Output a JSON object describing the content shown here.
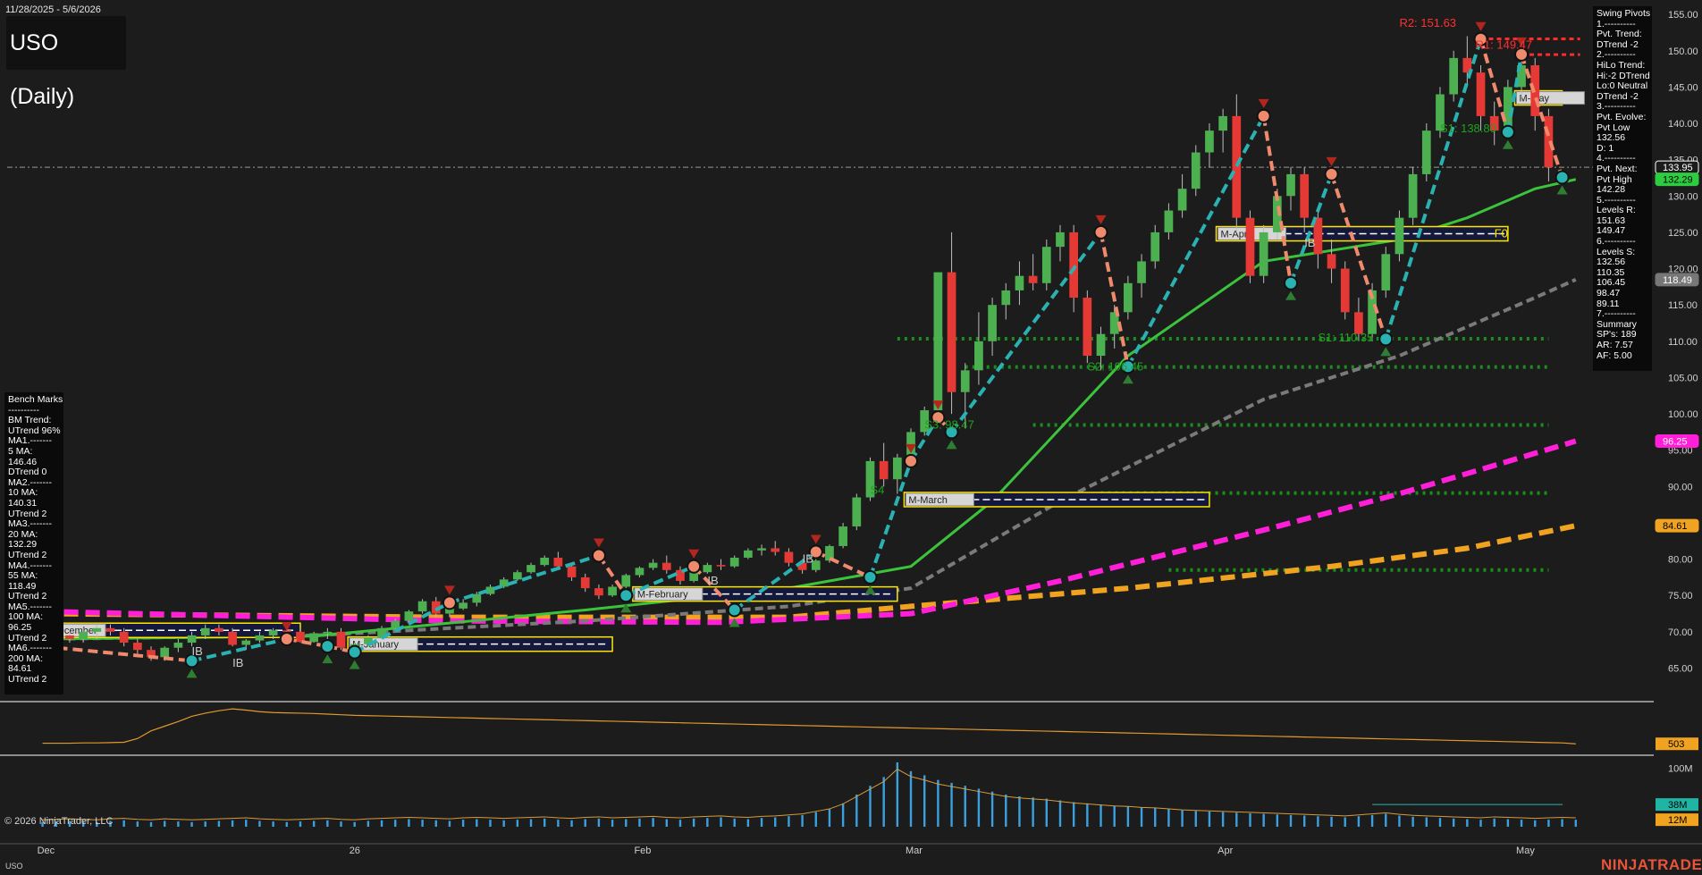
{
  "date_range": "11/28/2025 - 5/6/2026",
  "title": "USO (Daily)",
  "copyright": "© 2026 NinjaTrader, LLC",
  "ticker": "USO",
  "brand": "NINJATRADER",
  "swing_pivots": {
    "lines": [
      "Swing Pivots",
      "1.----------",
      "Pvt. Trend:",
      "DTrend -2",
      "2.----------",
      "HiLo Trend:",
      "Hi:-2 DTrend",
      "Lo:0 Neutral",
      "DTrend -2",
      "3.----------",
      "Pvt. Evolve:",
      "Pvt Low",
      "132.56",
      "D: 1",
      "4.----------",
      "Pvt. Next:",
      "Pvt High",
      "142.28",
      "5.----------",
      "Levels R:",
      "151.63",
      "149.47",
      "6.----------",
      "Levels S:",
      "132.56",
      "110.35",
      "106.45",
      "98.47",
      "89.11",
      "7.----------",
      "Summary",
      "SP's: 189",
      "AR: 7.57",
      "AF: 5.00"
    ]
  },
  "bench_marks": {
    "lines": [
      "Bench Marks",
      "----------",
      "BM Trend:",
      "UTrend 96%",
      "MA1.-------",
      "5 MA:",
      "146.46",
      "DTrend 0",
      "MA2.-------",
      "10 MA:",
      "140.31",
      "UTrend 2",
      "MA3.-------",
      "20 MA:",
      "132.29",
      "UTrend 2",
      "MA4.-------",
      "55 MA:",
      "118.49",
      "UTrend 2",
      "MA5.-------",
      "100 MA:",
      "96.25",
      "UTrend 2",
      "MA6.-------",
      "200 MA:",
      "84.61",
      "UTrend 2"
    ]
  },
  "annotations": {
    "r1": "R1: 149.47",
    "r2": "R2: 151.63",
    "s1_top": "S1: 138.80",
    "s1_mid": "S1: 110.35",
    "s2": "S2: 106.45",
    "s3": "S3: 98.47",
    "s4": "S4",
    "f0": "F0",
    "ib": "IB"
  },
  "month_boxes": [
    "M-December",
    "M-January",
    "M-February",
    "M-March",
    "M-April",
    "M-May"
  ],
  "colors": {
    "background": "#1c1c1c",
    "up_candle": "#4caf50",
    "down_candle": "#e53935",
    "ma5": "#c7c7c7",
    "ma20": "#3cc33c",
    "ma55": "#7a7a7a",
    "ma100": "#ff1fd8",
    "ma200": "#f0a321",
    "swing_up": "#2ab1b1",
    "swing_down": "#f08a6c",
    "resistance": "#ff2a2a",
    "support": "#1a8f1a"
  },
  "chart_data": {
    "type": "candlestick",
    "price_axis": {
      "min": 61,
      "max": 156,
      "ticks": [
        65,
        70,
        75,
        80,
        85,
        90,
        95,
        100,
        105,
        110,
        115,
        120,
        125,
        130,
        135,
        140,
        145,
        150,
        155
      ]
    },
    "x_labels": [
      {
        "label": "Dec",
        "idx": 0
      },
      {
        "label": "26",
        "idx": 23
      },
      {
        "label": "Feb",
        "idx": 44
      },
      {
        "label": "Mar",
        "idx": 64
      },
      {
        "label": "Apr",
        "idx": 87
      },
      {
        "label": "May",
        "idx": 109
      }
    ],
    "price_badges": [
      {
        "label": "133.95",
        "value": 133.95,
        "bg": "#1c1c1c",
        "fg": "#ffffff",
        "border": "#ffffff"
      },
      {
        "label": "132.29",
        "value": 132.29,
        "bg": "#2ecc40",
        "fg": "#000000",
        "border": "#2ecc40"
      },
      {
        "label": "118.49",
        "value": 118.49,
        "bg": "#777777",
        "fg": "#ffffff",
        "border": "#777777"
      },
      {
        "label": "96.25",
        "value": 96.25,
        "bg": "#ff1fd8",
        "fg": "#ffffff",
        "border": "#ff1fd8"
      },
      {
        "label": "84.61",
        "value": 84.61,
        "bg": "#f0a321",
        "fg": "#000000",
        "border": "#f0a321"
      }
    ],
    "candles": [
      [
        68,
        69,
        67,
        68.5
      ],
      [
        68.5,
        70,
        68,
        69.5
      ],
      [
        69.5,
        70,
        68.5,
        69
      ],
      [
        69,
        70.5,
        68.5,
        70
      ],
      [
        70,
        71,
        69,
        70.5
      ],
      [
        70.5,
        71,
        69.5,
        70
      ],
      [
        70,
        70.5,
        68,
        68.5
      ],
      [
        68.5,
        69,
        67,
        67.5
      ],
      [
        67.5,
        68,
        66,
        66.5
      ],
      [
        66.5,
        68,
        66,
        67.8
      ],
      [
        67.8,
        69,
        67.2,
        68.5
      ],
      [
        68.5,
        70,
        68,
        69.5
      ],
      [
        69.5,
        71,
        69,
        70.5
      ],
      [
        70.5,
        71,
        69.5,
        70
      ],
      [
        70,
        70.5,
        68,
        68.2
      ],
      [
        68.2,
        69,
        67.5,
        68.8
      ],
      [
        68.8,
        70,
        68.5,
        69.5
      ],
      [
        69.5,
        70.5,
        69,
        70.2
      ],
      [
        70.2,
        71,
        69.5,
        70
      ],
      [
        70,
        70.5,
        68.5,
        68.6
      ],
      [
        68.6,
        70,
        68.5,
        69.8
      ],
      [
        69.8,
        70.5,
        69,
        70
      ],
      [
        70,
        70.5,
        67.5,
        67.8
      ],
      [
        67.8,
        68.5,
        67,
        68.3
      ],
      [
        68.3,
        69.5,
        68,
        69.2
      ],
      [
        69.2,
        70.8,
        69,
        70.5
      ],
      [
        70.5,
        71.8,
        70.2,
        71.5
      ],
      [
        71.5,
        73,
        71,
        72.8
      ],
      [
        72.8,
        74.5,
        72.5,
        74.2
      ],
      [
        74.2,
        74.8,
        72,
        72.5
      ],
      [
        72.5,
        73.5,
        72,
        73.2
      ],
      [
        73.2,
        74.5,
        73,
        74
      ],
      [
        74,
        75.5,
        73.5,
        75.2
      ],
      [
        75.2,
        76.5,
        75,
        76.2
      ],
      [
        76.2,
        77.5,
        76,
        77.2
      ],
      [
        77.2,
        78.5,
        77,
        78.2
      ],
      [
        78.2,
        79.5,
        78,
        79.2
      ],
      [
        79.2,
        80.5,
        79,
        80.2
      ],
      [
        80.2,
        81,
        78.5,
        79
      ],
      [
        79,
        79.5,
        77,
        77.5
      ],
      [
        77.5,
        78,
        75.5,
        76
      ],
      [
        76,
        76.5,
        74.5,
        75
      ],
      [
        75,
        76.5,
        74.8,
        76.2
      ],
      [
        76.2,
        78,
        76,
        77.8
      ],
      [
        77.8,
        79,
        77.5,
        78.8
      ],
      [
        78.8,
        80,
        78.5,
        79.5
      ],
      [
        79.5,
        80.5,
        78,
        78.5
      ],
      [
        78.5,
        79,
        76.5,
        77
      ],
      [
        77,
        78.5,
        76.8,
        78.2
      ],
      [
        78.2,
        79.5,
        78,
        79.2
      ],
      [
        79.2,
        80,
        78.5,
        79
      ],
      [
        79,
        80.5,
        78.8,
        80.2
      ],
      [
        80.2,
        81.5,
        80,
        81.2
      ],
      [
        81.2,
        82,
        80.5,
        81.5
      ],
      [
        81.5,
        82.5,
        80.5,
        81
      ],
      [
        81,
        81.5,
        79,
        79.5
      ],
      [
        79.5,
        80,
        78,
        78.5
      ],
      [
        78.5,
        80,
        78.2,
        79.8
      ],
      [
        79.8,
        82,
        79.5,
        81.8
      ],
      [
        81.8,
        85,
        81.5,
        84.5
      ],
      [
        84.5,
        89,
        84,
        88.5
      ],
      [
        88.5,
        94,
        88,
        93.5
      ],
      [
        93.5,
        96,
        90,
        91
      ],
      [
        91,
        94.5,
        89,
        94
      ],
      [
        94,
        98,
        93,
        97.5
      ],
      [
        97.5,
        101,
        97,
        100.5
      ],
      [
        100.5,
        112,
        100,
        119.5
      ],
      [
        119.5,
        125,
        100,
        103
      ],
      [
        103,
        107,
        98,
        106
      ],
      [
        106,
        114,
        104,
        110
      ],
      [
        110,
        116,
        108,
        115
      ],
      [
        115,
        118,
        113,
        117
      ],
      [
        117,
        121,
        115,
        119
      ],
      [
        119,
        122,
        117,
        118
      ],
      [
        118,
        124,
        117,
        123
      ],
      [
        123,
        126,
        121,
        125
      ],
      [
        125,
        126,
        114,
        116
      ],
      [
        116,
        117,
        107,
        108
      ],
      [
        108,
        112,
        106,
        111
      ],
      [
        111,
        115,
        109,
        114
      ],
      [
        114,
        119,
        113,
        118
      ],
      [
        118,
        122,
        116,
        121
      ],
      [
        121,
        126,
        120,
        125
      ],
      [
        125,
        129,
        124,
        128
      ],
      [
        128,
        133,
        127,
        131
      ],
      [
        131,
        137,
        130,
        136
      ],
      [
        136,
        140,
        134,
        139
      ],
      [
        139,
        142,
        136,
        141
      ],
      [
        141,
        144,
        125,
        127
      ],
      [
        127,
        128,
        118,
        119
      ],
      [
        119,
        126,
        118,
        125
      ],
      [
        125,
        131,
        124,
        130
      ],
      [
        130,
        134,
        128,
        133
      ],
      [
        133,
        134,
        125,
        127
      ],
      [
        127,
        128,
        120,
        122
      ],
      [
        122,
        124,
        118,
        120
      ],
      [
        120,
        121,
        113,
        114
      ],
      [
        114,
        116,
        110,
        111
      ],
      [
        111,
        118,
        110,
        117
      ],
      [
        117,
        123,
        116,
        122
      ],
      [
        122,
        128,
        121,
        127
      ],
      [
        127,
        134,
        126,
        133
      ],
      [
        133,
        140,
        132,
        139
      ],
      [
        139,
        145,
        138,
        144
      ],
      [
        144,
        150,
        143,
        149
      ],
      [
        149,
        152,
        145,
        147
      ],
      [
        147,
        148,
        139,
        141
      ],
      [
        141,
        143,
        137,
        139
      ],
      [
        139,
        146,
        138,
        145
      ],
      [
        145,
        150,
        143,
        148
      ],
      [
        148,
        149,
        139,
        141
      ],
      [
        141,
        142,
        132,
        133.95
      ]
    ],
    "ma_series": {
      "ma20": [
        [
          0,
          69
        ],
        [
          20,
          69.4
        ],
        [
          40,
          73
        ],
        [
          55,
          76
        ],
        [
          64,
          79
        ],
        [
          70,
          88
        ],
        [
          80,
          108
        ],
        [
          90,
          121
        ],
        [
          100,
          124
        ],
        [
          105,
          127
        ],
        [
          110,
          131
        ],
        [
          113,
          132.29
        ]
      ],
      "ma55": [
        [
          0,
          69
        ],
        [
          20,
          69.5
        ],
        [
          40,
          71.5
        ],
        [
          55,
          73.5
        ],
        [
          64,
          76
        ],
        [
          75,
          88
        ],
        [
          90,
          102
        ],
        [
          100,
          108
        ],
        [
          110,
          116
        ],
        [
          113,
          118.49
        ]
      ],
      "ma100": [
        [
          0,
          72.8
        ],
        [
          30,
          71.5
        ],
        [
          50,
          71.3
        ],
        [
          64,
          72.5
        ],
        [
          75,
          77
        ],
        [
          90,
          84
        ],
        [
          100,
          89
        ],
        [
          113,
          96.25
        ]
      ],
      "ma200": [
        [
          0,
          72.5
        ],
        [
          30,
          72
        ],
        [
          55,
          72
        ],
        [
          64,
          73.5
        ],
        [
          80,
          76
        ],
        [
          95,
          79
        ],
        [
          105,
          81.5
        ],
        [
          113,
          84.61
        ]
      ]
    },
    "swing_points": [
      [
        0,
        68,
        "L"
      ],
      [
        11,
        66,
        "L"
      ],
      [
        18,
        69,
        "H"
      ],
      [
        21,
        68,
        "L"
      ],
      [
        23,
        67.2,
        "L"
      ],
      [
        30,
        74,
        "H"
      ],
      [
        41,
        80.5,
        "H"
      ],
      [
        43,
        75,
        "L"
      ],
      [
        48,
        79,
        "H"
      ],
      [
        51,
        73,
        "L"
      ],
      [
        57,
        81,
        "H"
      ],
      [
        61,
        77.5,
        "L"
      ],
      [
        64,
        93.5,
        "H"
      ],
      [
        66,
        99.5,
        "H"
      ],
      [
        67,
        97.5,
        "L"
      ],
      [
        78,
        125,
        "H"
      ],
      [
        80,
        106.5,
        "L"
      ],
      [
        90,
        141,
        "H"
      ],
      [
        92,
        118,
        "L"
      ],
      [
        95,
        133,
        "H"
      ],
      [
        99,
        110.3,
        "L"
      ],
      [
        106,
        151.6,
        "H"
      ],
      [
        108,
        138.8,
        "L"
      ],
      [
        109,
        149.5,
        "H"
      ],
      [
        112,
        132.56,
        "L"
      ]
    ],
    "resistance_levels": [
      {
        "value": 151.63,
        "from": 106
      },
      {
        "value": 149.47,
        "from": 109
      }
    ],
    "support_levels": [
      110.35,
      106.45,
      98.47,
      89.11,
      78.5
    ],
    "month_box_positions": [
      {
        "idx0": 0,
        "idx1": 19,
        "v": 70.2
      },
      {
        "idx0": 23,
        "idx1": 42,
        "v": 68.3
      },
      {
        "idx0": 44,
        "idx1": 63,
        "v": 75.2
      },
      {
        "idx0": 64,
        "idx1": 86,
        "v": 88.2
      },
      {
        "idx0": 87,
        "idx1": 108,
        "v": 124.8
      },
      {
        "idx0": 109,
        "idx1": 112,
        "v": 143.5
      }
    ],
    "ind1": {
      "axis_label": "503",
      "series": [
        505,
        505,
        505,
        506,
        506,
        507,
        508,
        520,
        545,
        560,
        575,
        592,
        602,
        610,
        616,
        612,
        607,
        604,
        603,
        602,
        601,
        599,
        597,
        595,
        594,
        593,
        592,
        591,
        590,
        589,
        588,
        587,
        586,
        585,
        584,
        583,
        582,
        581,
        580,
        579,
        578,
        577,
        576,
        575,
        574,
        573,
        572,
        571,
        570,
        569,
        568,
        567,
        566,
        565,
        564,
        563,
        562,
        561,
        560,
        559,
        558,
        557,
        556,
        555,
        554,
        553,
        552,
        551,
        550,
        549,
        548,
        547,
        546,
        545,
        544,
        543,
        542,
        541,
        540,
        539,
        538,
        537,
        536,
        535,
        534,
        533,
        532,
        531,
        530,
        529,
        528,
        527,
        526,
        525,
        524,
        523,
        522,
        521,
        520,
        519,
        518,
        517,
        516,
        515,
        514,
        513,
        512,
        511,
        510,
        509,
        508,
        507,
        506,
        503
      ]
    },
    "volume": {
      "axis_labels": [
        "100M",
        "38M",
        "12M"
      ],
      "values": [
        8,
        9,
        10,
        9,
        8,
        10,
        11,
        9,
        8,
        10,
        9,
        8,
        9,
        10,
        11,
        12,
        10,
        9,
        8,
        9,
        10,
        11,
        9,
        8,
        10,
        11,
        12,
        13,
        12,
        11,
        10,
        12,
        13,
        12,
        11,
        12,
        13,
        14,
        12,
        11,
        13,
        14,
        12,
        13,
        14,
        15,
        13,
        12,
        14,
        15,
        16,
        14,
        13,
        15,
        16,
        18,
        20,
        25,
        30,
        40,
        55,
        70,
        85,
        110,
        95,
        88,
        80,
        75,
        70,
        65,
        60,
        55,
        52,
        50,
        48,
        45,
        42,
        40,
        38,
        36,
        35,
        33,
        32,
        30,
        28,
        27,
        26,
        25,
        24,
        23,
        22,
        21,
        20,
        19,
        18,
        17,
        16,
        18,
        20,
        22,
        19,
        17,
        16,
        15,
        14,
        13,
        12,
        14,
        13,
        12,
        11,
        12,
        13,
        12
      ]
    }
  }
}
